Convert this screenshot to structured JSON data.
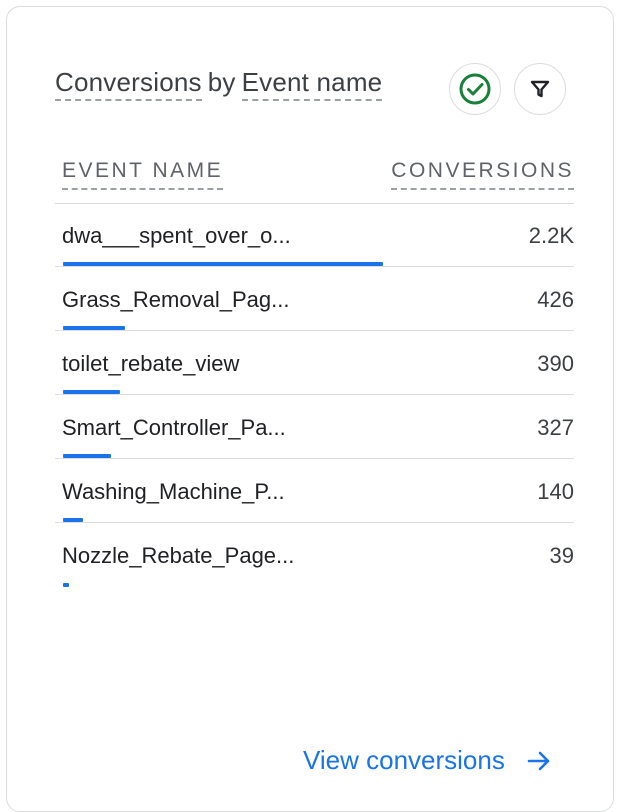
{
  "card": {
    "title_metric": "Conversions",
    "title_by": "by",
    "title_dimension": "Event name",
    "check_icon": "check-circle-icon",
    "filter_icon": "filter-icon"
  },
  "table": {
    "col_event_name": "EVENT NAME",
    "col_conversions": "CONVERSIONS",
    "max_value": 2200,
    "rows": [
      {
        "name": "dwa___spent_over_o...",
        "value_label": "2.2K",
        "value": 2200
      },
      {
        "name": "Grass_Removal_Pag...",
        "value_label": "426",
        "value": 426
      },
      {
        "name": "toilet_rebate_view",
        "value_label": "390",
        "value": 390
      },
      {
        "name": "Smart_Controller_Pa...",
        "value_label": "327",
        "value": 327
      },
      {
        "name": "Washing_Machine_P...",
        "value_label": "140",
        "value": 140
      },
      {
        "name": "Nozzle_Rebate_Page...",
        "value_label": "39",
        "value": 39
      }
    ]
  },
  "footer": {
    "link_label": "View conversions",
    "arrow_icon": "arrow-right-icon"
  },
  "colors": {
    "accent": "#1a73e8",
    "check_green": "#188038"
  }
}
